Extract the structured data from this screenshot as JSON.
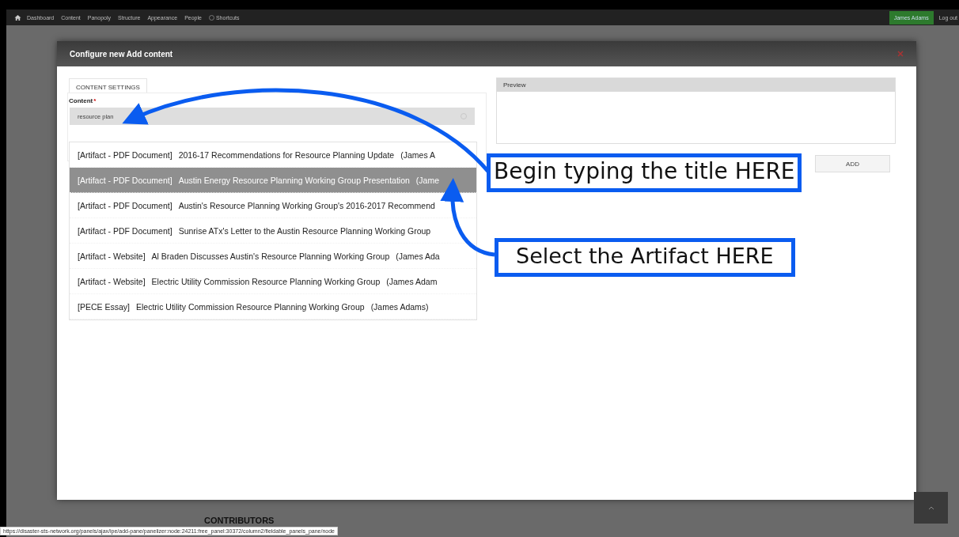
{
  "admin_bar": {
    "items": [
      "Dashboard",
      "Content",
      "Panopoly",
      "Structure",
      "Appearance",
      "People",
      "Shortcuts"
    ],
    "user": "James Adams",
    "logout": "Log out"
  },
  "modal": {
    "title": "Configure new Add content",
    "tab": "CONTENT SETTINGS",
    "field_label": "Content",
    "required_mark": "*",
    "field_value": "resource plan",
    "options": [
      {
        "type": "[Artifact - PDF Document]",
        "title": "2016-17 Recommendations for Resource Planning Update",
        "author": "(James A",
        "selected": false
      },
      {
        "type": "[Artifact - PDF Document]",
        "title": "Austin Energy Resource Planning Working Group Presentation",
        "author": "(Jame",
        "selected": true
      },
      {
        "type": "[Artifact - PDF Document]",
        "title": "Austin's Resource Planning Working Group's 2016-2017 Recommend",
        "selected": false
      },
      {
        "type": "[Artifact - PDF Document]",
        "title": "Sunrise ATx's Letter to the Austin Resource Planning Working Group",
        "selected": false
      },
      {
        "type": "[Artifact - Website]",
        "title": "Al Braden Discusses Austin's Resource Planning Working Group",
        "author": "(James Ada",
        "selected": false
      },
      {
        "type": "[Artifact - Website]",
        "title": "Electric Utility Commission Resource Planning Working Group",
        "author": "(James Adam",
        "selected": false
      },
      {
        "type": "[PECE Essay]",
        "title": "Electric Utility Commission Resource Planning Working Group",
        "author": "(James Adams)",
        "selected": false
      }
    ],
    "preview_label": "Preview",
    "add_button": "ADD"
  },
  "callouts": [
    "Begin typing the title HERE",
    "Select the Artifact HERE"
  ],
  "background_heading": "CONTRIBUTORS",
  "status_url": "https://disaster-sts-network.org/panels/ajax/ipe/add-pane/panelizer:node:24211:free_panel:30372/column2/fieldable_panels_pane/node"
}
